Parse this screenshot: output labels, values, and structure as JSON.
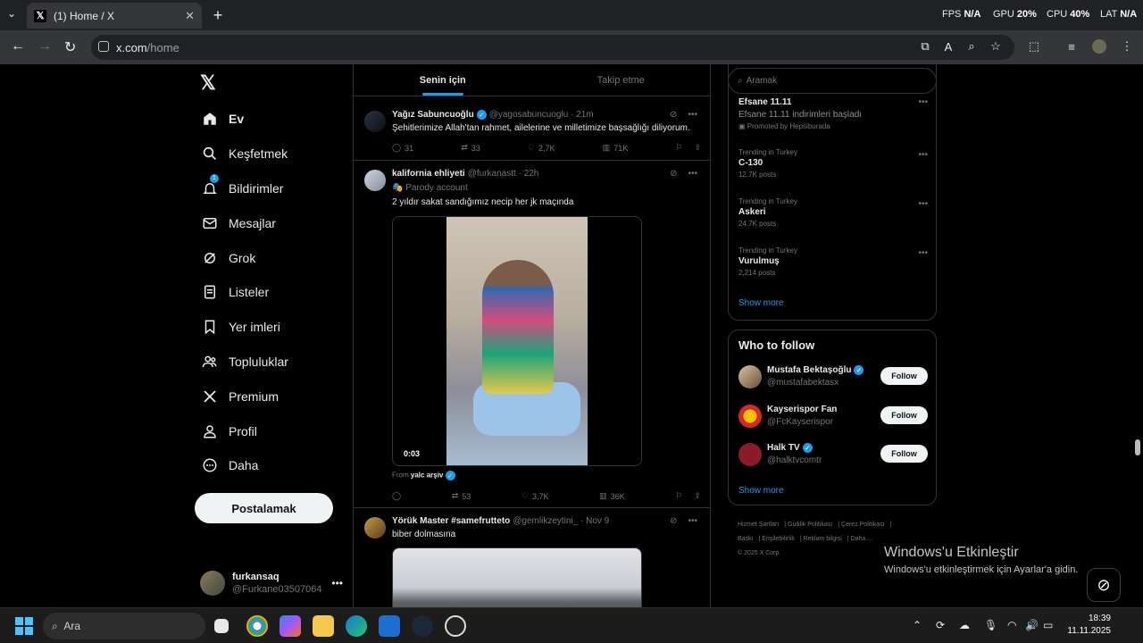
{
  "browser": {
    "tab_title": "(1) Home / X",
    "url_host": "x.com",
    "url_path": "/home",
    "overlay": {
      "fps_label": "FPS",
      "fps_value": "N/A",
      "gpu_label": "GPU",
      "gpu_value": "20%",
      "cpu_label": "CPU",
      "cpu_value": "40%",
      "lat_label": "LAT",
      "lat_value": "N/A"
    }
  },
  "sidebar": {
    "items": [
      {
        "label": "Ev",
        "icon": "home-icon"
      },
      {
        "label": "Keşfetmek",
        "icon": "search-icon"
      },
      {
        "label": "Bildirimler",
        "icon": "bell-icon",
        "badge": "1"
      },
      {
        "label": "Mesajlar",
        "icon": "mail-icon"
      },
      {
        "label": "Grok",
        "icon": "grok-icon"
      },
      {
        "label": "Listeler",
        "icon": "list-icon"
      },
      {
        "label": "Yer imleri",
        "icon": "bookmark-icon"
      },
      {
        "label": "Topluluklar",
        "icon": "communities-icon"
      },
      {
        "label": "Premium",
        "icon": "x-icon"
      },
      {
        "label": "Profil",
        "icon": "profile-icon"
      },
      {
        "label": "Daha",
        "icon": "more-icon"
      }
    ],
    "post_label": "Postalamak",
    "account": {
      "name": "furkansaq",
      "handle": "@Furkane03507064"
    }
  },
  "feed": {
    "tabs": [
      "Senin için",
      "Takip etme"
    ],
    "tweets": [
      {
        "name": "Yağız Sabuncuoğlu",
        "handle": "@yagosabuncuoglu",
        "time": "21m",
        "text": "Şehitlerimize Allah'tan rahmet, ailelerine ve milletimize başsağlığı diliyorum.",
        "replies": "31",
        "reposts": "33",
        "likes": "2,7K",
        "views": "71K"
      },
      {
        "name": "kalifornia ehliyeti",
        "handle": "@furkanastt",
        "time": "22h",
        "parody": "Parody account",
        "text": "2 yıldır sakat sandığımız necip her jk maçında",
        "video_time": "0:03",
        "from_label": "From",
        "from_name": "yalc arşiv",
        "replies": "",
        "reposts": "53",
        "likes": "3,7K",
        "views": "36K"
      },
      {
        "name": "Yörük Master #samefrutteto",
        "handle": "@gemlikzeytini_",
        "time": "Nov 9",
        "text": "biber dolmasına"
      }
    ]
  },
  "right": {
    "search_placeholder": "Aramak",
    "trends": [
      {
        "context": "",
        "title": "Efsane 11.11",
        "count": "Efsane 11.11 indirimleri başladı",
        "promo": "Promoted by Hepsiburada"
      },
      {
        "context": "Trending in Turkey",
        "title": "C-130",
        "count": "12.7K posts"
      },
      {
        "context": "Trending in Turkey",
        "title": "Askeri",
        "count": "24.7K posts"
      },
      {
        "context": "Trending in Turkey",
        "title": "Vurulmuş",
        "count": "2,214 posts"
      }
    ],
    "show_more": "Show more",
    "who_to_follow_title": "Who to follow",
    "follow": [
      {
        "name": "Mustafa Bektaşoğlu",
        "handle": "@mustafabektasx",
        "verified": true,
        "button": "Follow"
      },
      {
        "name": "Kayserispor Fan",
        "handle": "@FcKayserispor",
        "verified": false,
        "button": "Follow"
      },
      {
        "name": "Halk TV",
        "handle": "@halktvcomtr",
        "verified": true,
        "button": "Follow"
      }
    ],
    "footer": [
      "Hizmet Şartları",
      "Gizlilik Politikası",
      "Çerez Politikası",
      "Baskı",
      "Erişilebilirlik",
      "Reklam bilgisi",
      "Daha ...",
      "© 2025 X Corp."
    ]
  },
  "windows": {
    "activate_title": "Windows'u Etkinleştir",
    "activate_text": "Windows'u etkinleştirmek için Ayarlar'a gidin.",
    "search_placeholder": "Ara",
    "time": "18:39",
    "date": "11.11.2025"
  }
}
